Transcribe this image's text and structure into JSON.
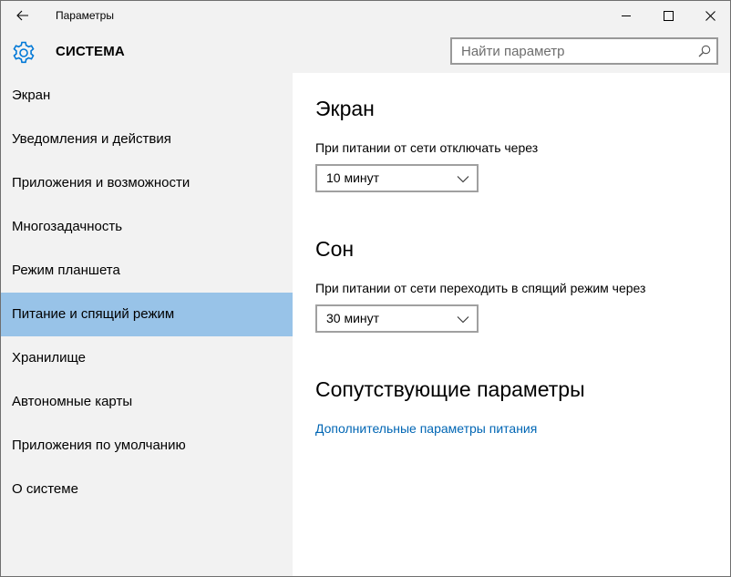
{
  "window": {
    "title": "Параметры"
  },
  "header": {
    "title": "СИСТЕМА",
    "icon": "gear-icon",
    "search_placeholder": "Найти параметр"
  },
  "sidebar": {
    "items": [
      {
        "label": "Экран"
      },
      {
        "label": "Уведомления и действия"
      },
      {
        "label": "Приложения и возможности"
      },
      {
        "label": "Многозадачность"
      },
      {
        "label": "Режим планшета"
      },
      {
        "label": "Питание и спящий режим",
        "selected": true
      },
      {
        "label": "Хранилище"
      },
      {
        "label": "Автономные карты"
      },
      {
        "label": "Приложения по умолчанию"
      },
      {
        "label": "О системе"
      }
    ]
  },
  "main": {
    "screen_section": {
      "title": "Экран",
      "label": "При питании от сети отключать через",
      "value": "10 минут"
    },
    "sleep_section": {
      "title": "Сон",
      "label": "При питании от сети переходить в спящий режим через",
      "value": "30 минут"
    },
    "related_section": {
      "title": "Сопутствующие параметры",
      "link": "Дополнительные параметры питания"
    }
  },
  "colors": {
    "accent": "#0078d7",
    "selected_item": "#98c3e8",
    "sidebar_bg": "#f2f2f2",
    "link": "#0066b4"
  }
}
